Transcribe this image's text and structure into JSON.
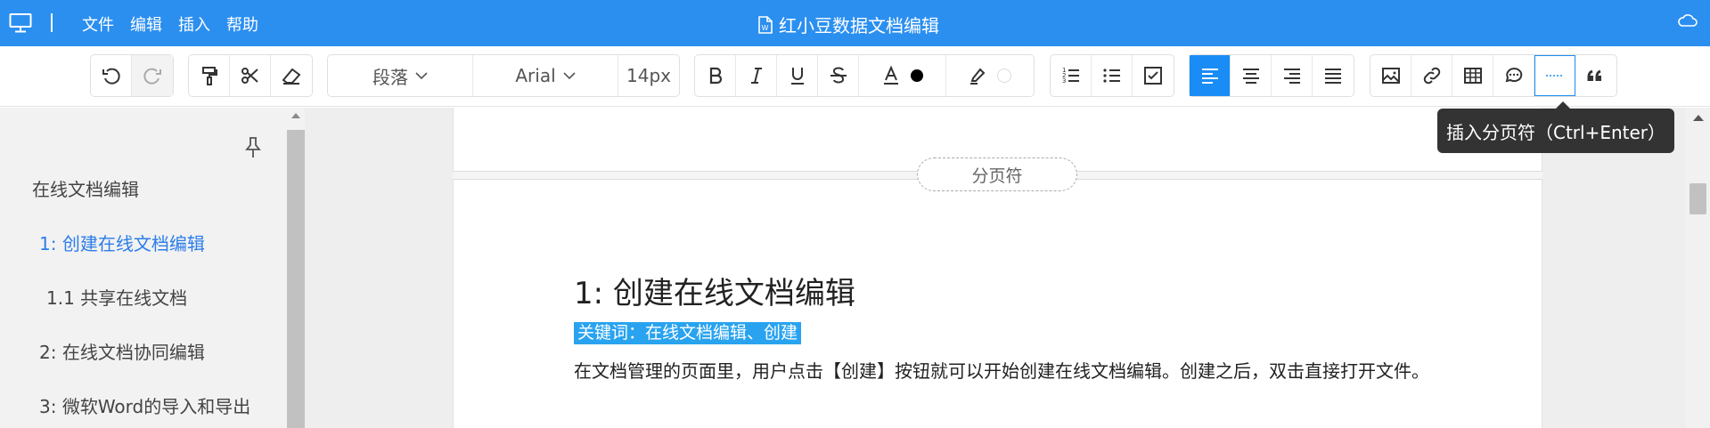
{
  "app": {
    "title": "红小豆数据文档编辑",
    "menu": [
      "文件",
      "编辑",
      "插入",
      "帮助"
    ]
  },
  "toolbar": {
    "paragraph_style": "段落",
    "font_family": "Arial",
    "font_size": "14px",
    "text_color": "#000000",
    "highlight_color": "#ffffff",
    "accent_color": "#1a8cf5"
  },
  "tooltip": "插入分页符（Ctrl+Enter）",
  "sidebar": {
    "items": [
      {
        "label": "在线文档编辑",
        "active": false
      },
      {
        "label": "1: 创建在线文档编辑",
        "active": true
      },
      {
        "label": "1.1 共享在线文档",
        "active": false
      },
      {
        "label": "2: 在线文档协同编辑",
        "active": false
      },
      {
        "label": "3: 微软Word的导入和导出",
        "active": false
      }
    ]
  },
  "document": {
    "page_break_label": "分页符",
    "heading": "1: 创建在线文档编辑",
    "keywords": "关键词：在线文档编辑、创建",
    "paragraph": "在文档管理的页面里，用户点击【创建】按钮就可以开始创建在线文档编辑。创建之后，双击直接打开文件。"
  }
}
